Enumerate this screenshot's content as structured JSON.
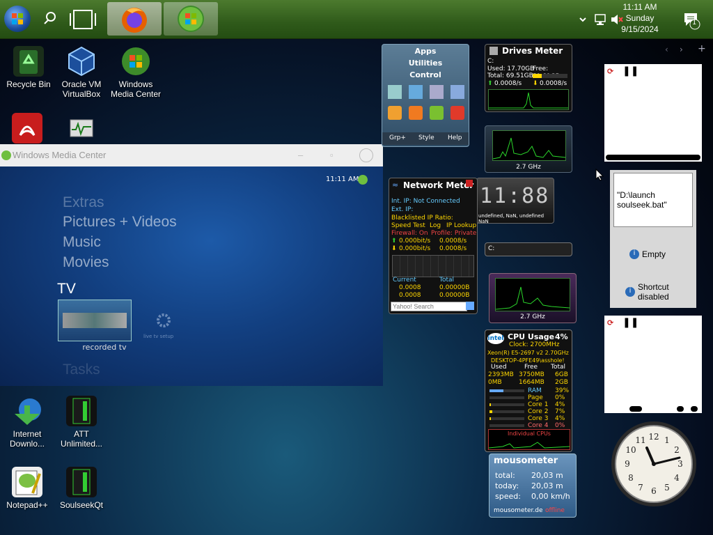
{
  "taskbar": {
    "start_button": "start-orb",
    "search_icon": "search-icon",
    "taskview_icon": "task-view-icon",
    "pinned": [
      {
        "name": "Firefox",
        "icon": "firefox-icon"
      },
      {
        "name": "Windows Media Center",
        "icon": "windows-logo-icon"
      }
    ],
    "tray": {
      "chevron": "chevron-up-icon",
      "network_icon": "network-icon",
      "volume_icon": "volume-muted-icon",
      "time": "11:11 AM",
      "day": "Sunday",
      "date": "9/15/2024",
      "notification_count": "1"
    }
  },
  "desktop_icons": [
    {
      "label": "Recycle Bin",
      "icon": "recycle-bin-icon"
    },
    {
      "label": "Oracle VM VirtualBox",
      "icon": "virtualbox-icon"
    },
    {
      "label": "Windows Media Center",
      "icon": "windows-logo-icon"
    },
    {
      "label": "",
      "icon": "pdf-icon"
    },
    {
      "label": "",
      "icon": "monitor-icon"
    },
    {
      "label": "Internet Downlo...",
      "icon": "download-manager-icon"
    },
    {
      "label": "ATT Unlimited...",
      "icon": "att-icon"
    },
    {
      "label": "Notepad++",
      "icon": "notepad-icon"
    },
    {
      "label": "SoulseekQt",
      "icon": "soulseek-icon"
    }
  ],
  "wmc": {
    "title": "Windows Media Center",
    "time": "11:11 AM",
    "menu": [
      "Extras",
      "Pictures + Videos",
      "Music",
      "Movies"
    ],
    "section": "TV",
    "tile_recorded": "recorded tv",
    "tile_live": "live tv setup",
    "tasks": "Tasks"
  },
  "control_gadget": {
    "tabs": [
      "Apps",
      "Utilities",
      "Control"
    ],
    "footer": [
      "Grp+",
      "Style",
      "Help"
    ]
  },
  "drives_meter": {
    "title": "Drives Meter",
    "drive": "C:",
    "used": "Used: 17.70GB",
    "free": "Free: 51.81GB",
    "total": "Total: 69.51GB",
    "read": "0.0008/s",
    "write": "0.0008/s"
  },
  "cpu_graph1": {
    "freq": "2.7 GHz"
  },
  "cpu_graph2": {
    "freq": "2.7 GHz"
  },
  "digital_clock": {
    "time": "11:88",
    "error": "undefined, NaN, undefined NaN"
  },
  "drive_bar": {
    "label": "C:"
  },
  "network_meter": {
    "title": "Network Meter",
    "int_ip": "Int. IP: Not Connected",
    "ext_ip": "Ext. IP:",
    "blacklisted": "Blacklisted IP Ratio:",
    "speedtest": "Speed Test",
    "log": "Log",
    "iplookup": "IP Lookup",
    "firewall": "Firewall: On",
    "profile": "Profile: Private",
    "up1": "0.000bit/s",
    "up2": "0.0008/s",
    "down1": "0.000bit/s",
    "down2": "0.0008/s",
    "current": "Current",
    "total": "Total",
    "cur_up": "0.0008",
    "tot_up": "0.00000B",
    "cur_down": "0.0008",
    "tot_down": "0.00000B",
    "search_placeholder": "Yahoo! Search"
  },
  "cpu_usage": {
    "brand": "intel",
    "title": "CPU Usage",
    "percent": "4%",
    "clock": "Clock: 2700MHz",
    "cpu": "Xeon(R) E5-2697 v2 2.70GHz",
    "host": "DESKTOP-4PFE49\\asshole!",
    "headers": [
      "Used",
      "Free",
      "Total"
    ],
    "row1": [
      "2393MB",
      "3750MB",
      "6GB"
    ],
    "row2": [
      "0MB",
      "1664MB",
      "2GB"
    ],
    "bars": [
      {
        "label": "RAM",
        "value": "39%"
      },
      {
        "label": "Page",
        "value": "0%"
      },
      {
        "label": "Core 1",
        "value": "4%"
      },
      {
        "label": "Core 2",
        "value": "7%"
      },
      {
        "label": "Core 3",
        "value": "4%"
      },
      {
        "label": "Core 4",
        "value": "0%"
      }
    ],
    "status": "Individual CPUs"
  },
  "mousometer": {
    "title": "mousometer",
    "total_label": "total:",
    "total": "20,03 m",
    "today_label": "today:",
    "today": "20,03 m",
    "speed_label": "speed:",
    "speed": "0,00 km/h",
    "site": "mousometer.de",
    "offline": "offline"
  },
  "sidebar_controls": [
    "‹",
    "›",
    "+"
  ],
  "launcher": {
    "path": "\"D:\\launch soulseek.bat\"",
    "empty": "Empty",
    "shortcut": "Shortcut disabled"
  },
  "colors": {
    "accent_green": "#3a7a22",
    "gadget_green": "#2bd82b",
    "meter_yellow": "#ffd700"
  }
}
